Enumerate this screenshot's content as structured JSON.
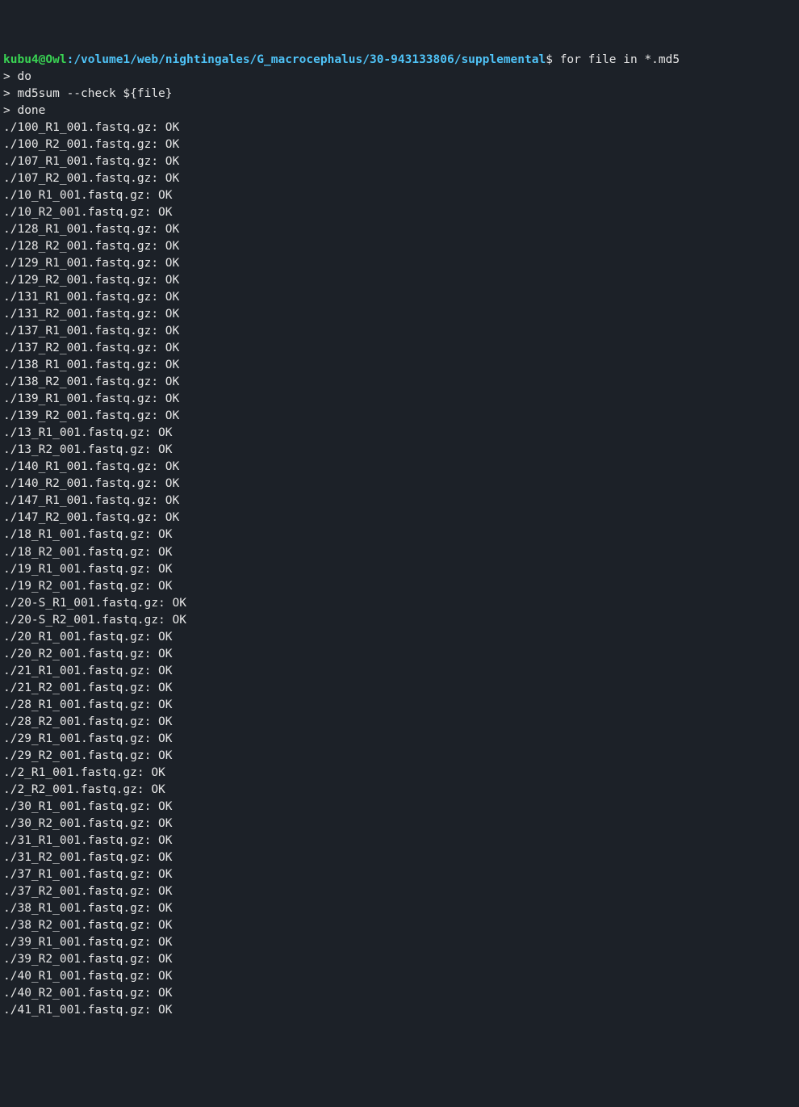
{
  "prompt": {
    "user": "kubu4@Owl",
    "colon": ":",
    "path": "/volume1/web/nightingales/G_macrocephalus/30-943133806/supplemental",
    "dollar": "$",
    "command": "for file in *.md5"
  },
  "continuations": [
    "> do",
    "> md5sum --check ${file}",
    "> done"
  ],
  "output": [
    "./100_R1_001.fastq.gz: OK",
    "./100_R2_001.fastq.gz: OK",
    "./107_R1_001.fastq.gz: OK",
    "./107_R2_001.fastq.gz: OK",
    "./10_R1_001.fastq.gz: OK",
    "./10_R2_001.fastq.gz: OK",
    "./128_R1_001.fastq.gz: OK",
    "./128_R2_001.fastq.gz: OK",
    "./129_R1_001.fastq.gz: OK",
    "./129_R2_001.fastq.gz: OK",
    "./131_R1_001.fastq.gz: OK",
    "./131_R2_001.fastq.gz: OK",
    "./137_R1_001.fastq.gz: OK",
    "./137_R2_001.fastq.gz: OK",
    "./138_R1_001.fastq.gz: OK",
    "./138_R2_001.fastq.gz: OK",
    "./139_R1_001.fastq.gz: OK",
    "./139_R2_001.fastq.gz: OK",
    "./13_R1_001.fastq.gz: OK",
    "./13_R2_001.fastq.gz: OK",
    "./140_R1_001.fastq.gz: OK",
    "./140_R2_001.fastq.gz: OK",
    "./147_R1_001.fastq.gz: OK",
    "./147_R2_001.fastq.gz: OK",
    "./18_R1_001.fastq.gz: OK",
    "./18_R2_001.fastq.gz: OK",
    "./19_R1_001.fastq.gz: OK",
    "./19_R2_001.fastq.gz: OK",
    "./20-S_R1_001.fastq.gz: OK",
    "./20-S_R2_001.fastq.gz: OK",
    "./20_R1_001.fastq.gz: OK",
    "./20_R2_001.fastq.gz: OK",
    "./21_R1_001.fastq.gz: OK",
    "./21_R2_001.fastq.gz: OK",
    "./28_R1_001.fastq.gz: OK",
    "./28_R2_001.fastq.gz: OK",
    "./29_R1_001.fastq.gz: OK",
    "./29_R2_001.fastq.gz: OK",
    "./2_R1_001.fastq.gz: OK",
    "./2_R2_001.fastq.gz: OK",
    "./30_R1_001.fastq.gz: OK",
    "./30_R2_001.fastq.gz: OK",
    "./31_R1_001.fastq.gz: OK",
    "./31_R2_001.fastq.gz: OK",
    "./37_R1_001.fastq.gz: OK",
    "./37_R2_001.fastq.gz: OK",
    "./38_R1_001.fastq.gz: OK",
    "./38_R2_001.fastq.gz: OK",
    "./39_R1_001.fastq.gz: OK",
    "./39_R2_001.fastq.gz: OK",
    "./40_R1_001.fastq.gz: OK",
    "./40_R2_001.fastq.gz: OK",
    "./41_R1_001.fastq.gz: OK"
  ]
}
